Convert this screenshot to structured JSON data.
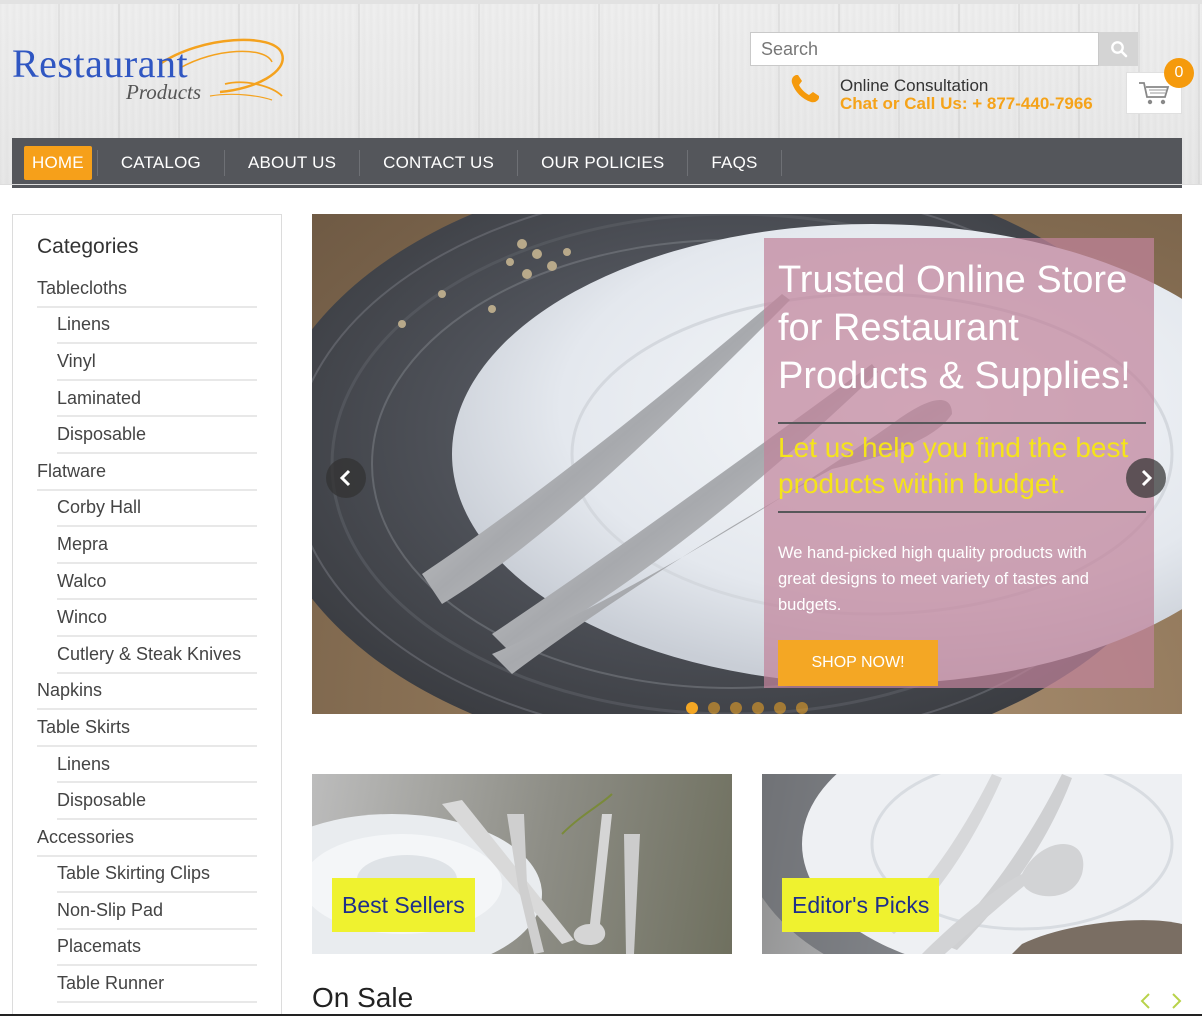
{
  "header": {
    "logo_main": "Restaurant",
    "logo_sub": "Products",
    "search": {
      "placeholder": "Search",
      "value": ""
    },
    "search_icon": "search-icon",
    "consultation_title": "Online Consultation",
    "consultation_phone": "Chat or Call Us: + 877-440-7966",
    "cart_count": "0",
    "accent_color": "#f6a01a"
  },
  "nav": {
    "items": [
      {
        "label": "HOME",
        "active": true
      },
      {
        "label": "CATALOG"
      },
      {
        "label": "ABOUT US"
      },
      {
        "label": "CONTACT US"
      },
      {
        "label": "OUR POLICIES"
      },
      {
        "label": "FAQS"
      }
    ]
  },
  "sidebar": {
    "title": "Categories",
    "items": [
      {
        "label": "Tablecloths",
        "sub": false
      },
      {
        "label": "Linens",
        "sub": true
      },
      {
        "label": "Vinyl",
        "sub": true
      },
      {
        "label": "Laminated",
        "sub": true
      },
      {
        "label": "Disposable",
        "sub": true
      },
      {
        "label": "Flatware",
        "sub": false
      },
      {
        "label": "Corby Hall",
        "sub": true
      },
      {
        "label": "Mepra",
        "sub": true
      },
      {
        "label": "Walco",
        "sub": true
      },
      {
        "label": "Winco",
        "sub": true
      },
      {
        "label": "Cutlery & Steak Knives",
        "sub": true
      },
      {
        "label": "Napkins",
        "sub": false
      },
      {
        "label": "Table Skirts",
        "sub": false
      },
      {
        "label": "Linens",
        "sub": true
      },
      {
        "label": "Disposable",
        "sub": true
      },
      {
        "label": "Accessories",
        "sub": false
      },
      {
        "label": "Table Skirting Clips",
        "sub": true
      },
      {
        "label": "Non-Slip Pad",
        "sub": true
      },
      {
        "label": "Placemats",
        "sub": true
      },
      {
        "label": "Table Runner",
        "sub": true
      }
    ]
  },
  "hero": {
    "title": "Trusted Online Store for Restaurant Products & Supplies!",
    "subtitle": "Let us help you find the best products within budget.",
    "description": "We hand-picked high quality products with great designs to meet variety of tastes and budgets.",
    "button_label": "SHOP NOW!",
    "slide_count": 6,
    "active_slide": 1
  },
  "tiles": {
    "best_sellers": "Best Sellers",
    "editors_picks": "Editor's Picks"
  },
  "on_sale": {
    "heading": "On Sale"
  }
}
